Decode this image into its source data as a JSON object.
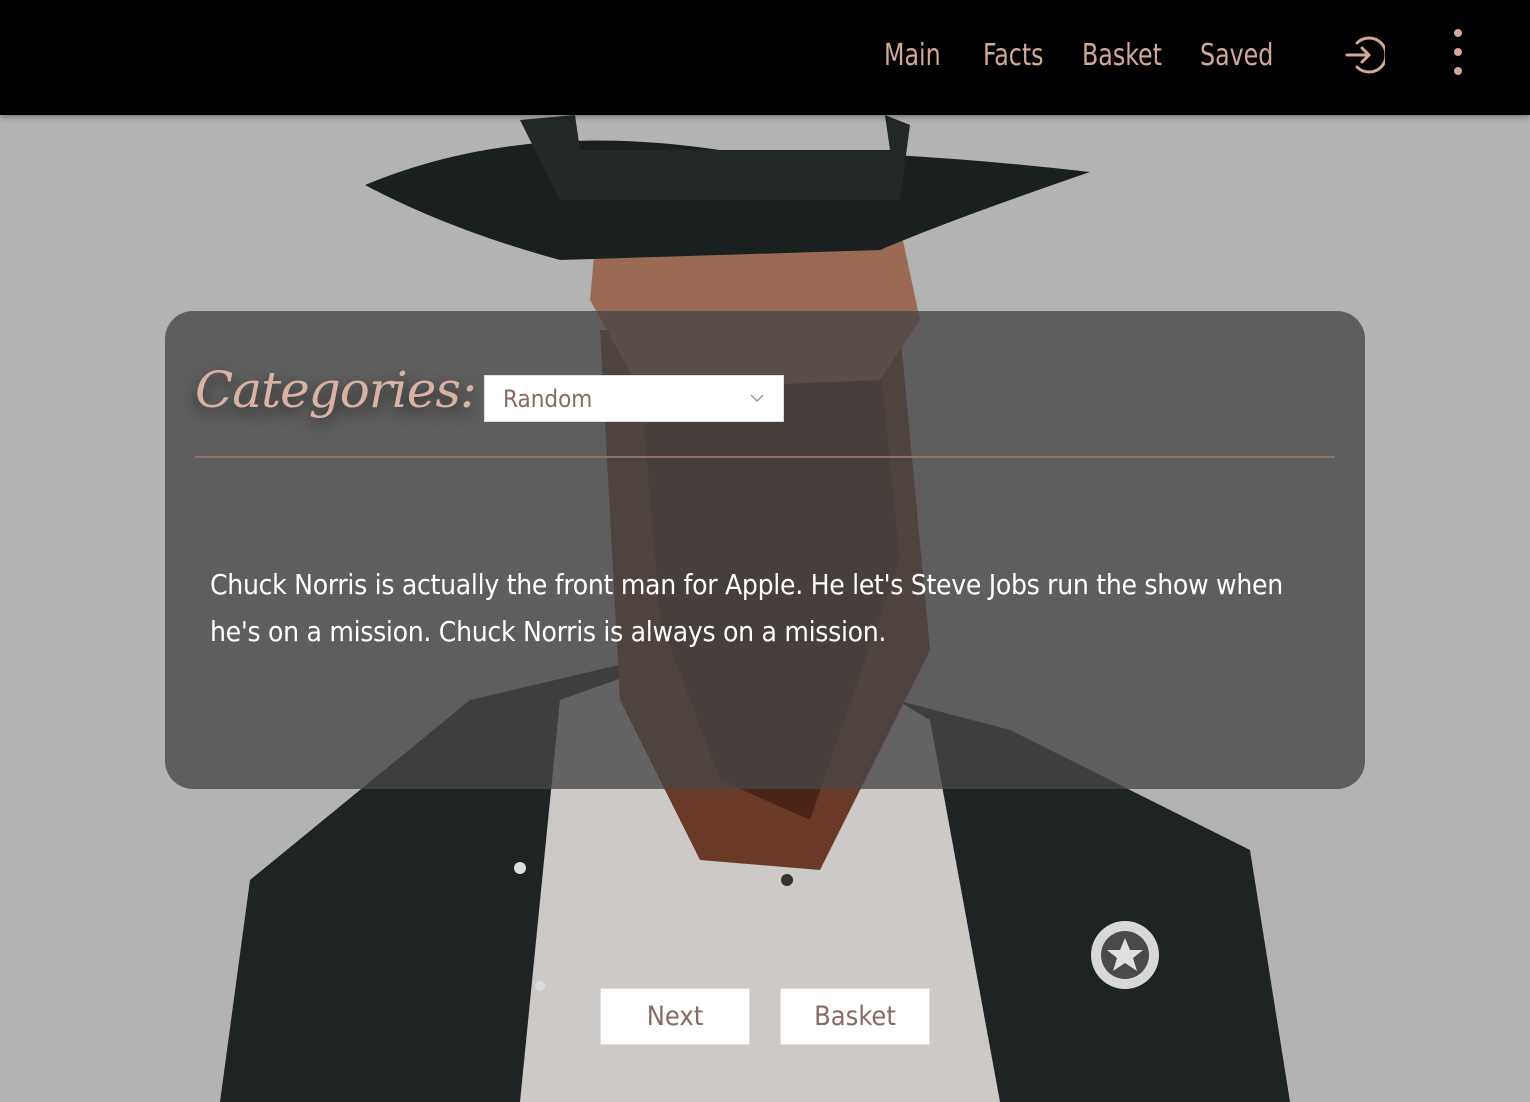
{
  "nav": {
    "items": [
      "Main",
      "Facts",
      "Basket",
      "Saved"
    ]
  },
  "icons": {
    "login": "login-icon",
    "more": "more-vertical-icon",
    "dropdown": "chevron-down-icon"
  },
  "categories": {
    "label": "Categories:",
    "selected": "Random"
  },
  "fact": {
    "text": "Chuck Norris is actually the front man for Apple. He let's Steve Jobs run the show when he's on a mission. Chuck Norris is always on a mission."
  },
  "buttons": {
    "next": "Next",
    "basket": "Basket"
  },
  "colors": {
    "accent": "#d4a892",
    "header_bg": "#000000",
    "page_bg": "#b3b3b3",
    "panel_bg": "#464646"
  }
}
